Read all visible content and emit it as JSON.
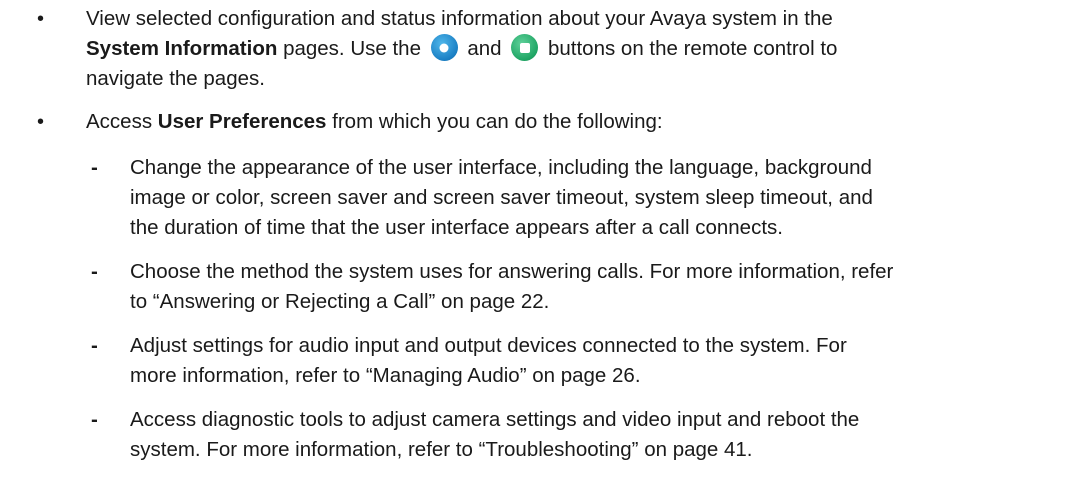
{
  "items": [
    {
      "l1_pre": "View selected configuration and status information about your Avaya system in the",
      "l2_bold": "System Information",
      "l2_mid1": " pages. Use the ",
      "l2_mid2": " and ",
      "l2_post": " buttons on the remote control to",
      "l3": "navigate the pages.",
      "icon1": "blue-circle-button-icon",
      "icon2": "green-square-button-icon"
    },
    {
      "pre": "Access ",
      "bold": "User Preferences",
      "post": " from which you can do the following:"
    }
  ],
  "subitems": [
    {
      "lines": [
        "Change the appearance of the user interface, including the language, background",
        "image or color, screen saver and screen saver timeout, system sleep timeout, and",
        "the duration of time that the user interface appears after a call connects."
      ]
    },
    {
      "lines": [
        "Choose the method the system uses for answering calls. For more information, refer",
        "to “Answering or Rejecting a Call” on page 22."
      ]
    },
    {
      "lines": [
        "Adjust settings for audio input and output devices connected to the system. For",
        "more information, refer to “Managing Audio” on page 26."
      ]
    },
    {
      "lines": [
        "Access diagnostic tools to adjust camera settings and video input and reboot the",
        "system. For more information, refer to “Troubleshooting” on page 41."
      ]
    }
  ],
  "bullet_char": "•",
  "dash_char": "-",
  "colors": {
    "text": "#1a1a1a",
    "blue_button": "#1a7fc4",
    "green_button": "#1fa564"
  }
}
